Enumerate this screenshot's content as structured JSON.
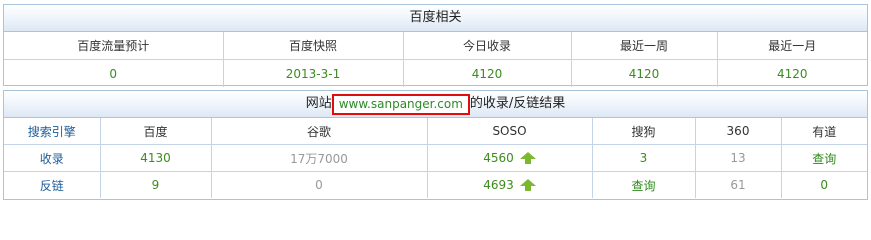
{
  "baidu": {
    "title": "百度相关",
    "headers": [
      "百度流量预计",
      "百度快照",
      "今日收录",
      "最近一周",
      "最近一月"
    ],
    "values": [
      "0",
      "2013-3-1",
      "4120",
      "4120",
      "4120"
    ]
  },
  "site": {
    "title_prefix": "网站",
    "url": "www.sanpanger.com",
    "title_suffix": "的收录/反链结果",
    "columns": [
      "搜索引擎",
      "百度",
      "谷歌",
      "SOSO",
      "搜狗",
      "360",
      "有道"
    ],
    "index_row": {
      "label": "收录",
      "baidu": "4130",
      "google": "17万7000",
      "soso": "4560",
      "sogou": "3",
      "so360": "13",
      "youdao": "查询"
    },
    "backlink_row": {
      "label": "反链",
      "baidu": "9",
      "google": "0",
      "soso": "4693",
      "sogou": "查询",
      "so360": "61",
      "youdao": "0"
    },
    "icons": {
      "trend": "up-arrow-icon"
    },
    "colors": {
      "up_arrow": "#7cb82f",
      "url_highlight": "#e10c0c",
      "value_green": "#3c8c1e"
    }
  }
}
